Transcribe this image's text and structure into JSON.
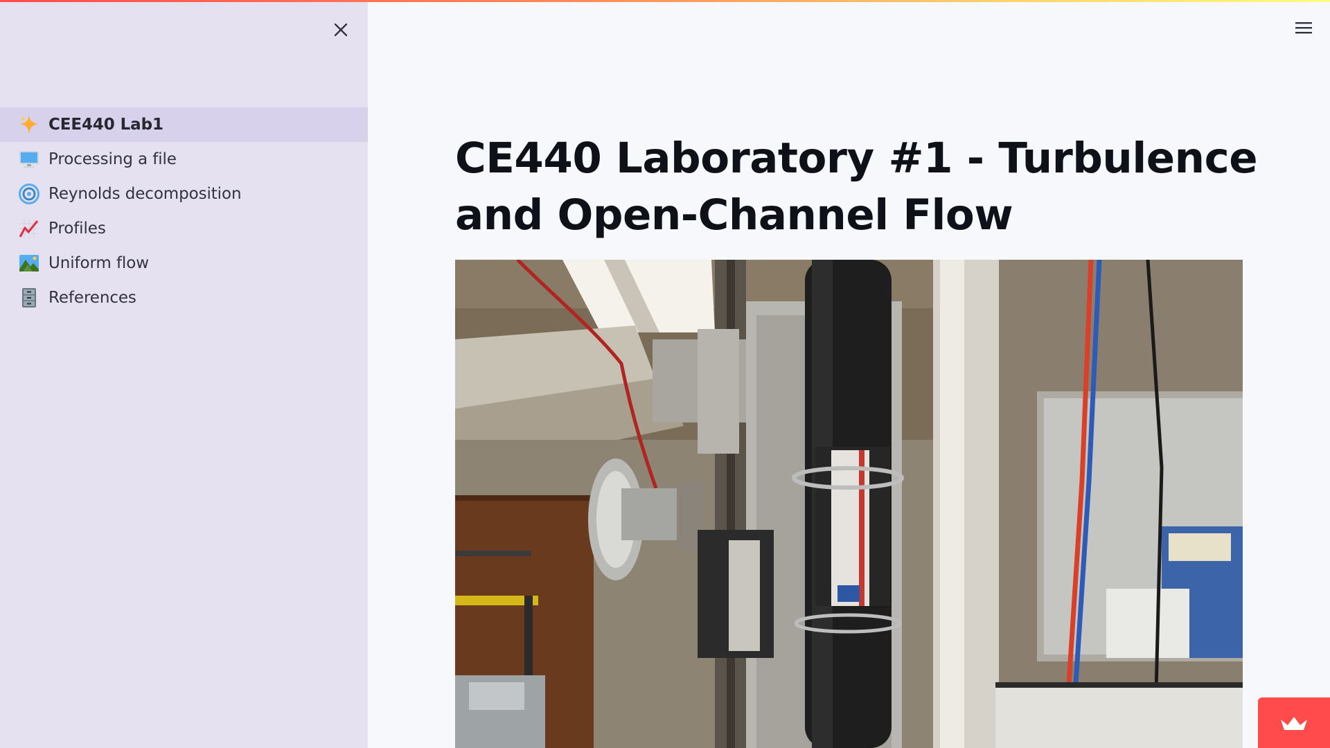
{
  "app": {
    "page_title": "CE440 Laboratory #1 - Turbulence and Open-Channel Flow",
    "accent_color": "#ff4b4b"
  },
  "sidebar": {
    "background": "#e6e1f1",
    "close_icon": "close-icon",
    "items": [
      {
        "label": "CEE440 Lab1",
        "icon": "sparkles-icon",
        "active": true
      },
      {
        "label": "Processing a file",
        "icon": "computer-icon",
        "active": false
      },
      {
        "label": "Reynolds decomposition",
        "icon": "cyclone-icon",
        "active": false
      },
      {
        "label": "Profiles",
        "icon": "chart-increasing-icon",
        "active": false
      },
      {
        "label": "Uniform flow",
        "icon": "landscape-picture-icon",
        "active": false
      },
      {
        "label": "References",
        "icon": "file-cabinet-icon",
        "active": false
      }
    ]
  },
  "header": {
    "menu_icon": "hamburger-menu-icon"
  },
  "main": {
    "image_alt": "Laboratory photo of an acoustic Doppler velocimeter probe mounted on a traverse beside a flume"
  },
  "badge": {
    "icon": "crown-icon"
  }
}
